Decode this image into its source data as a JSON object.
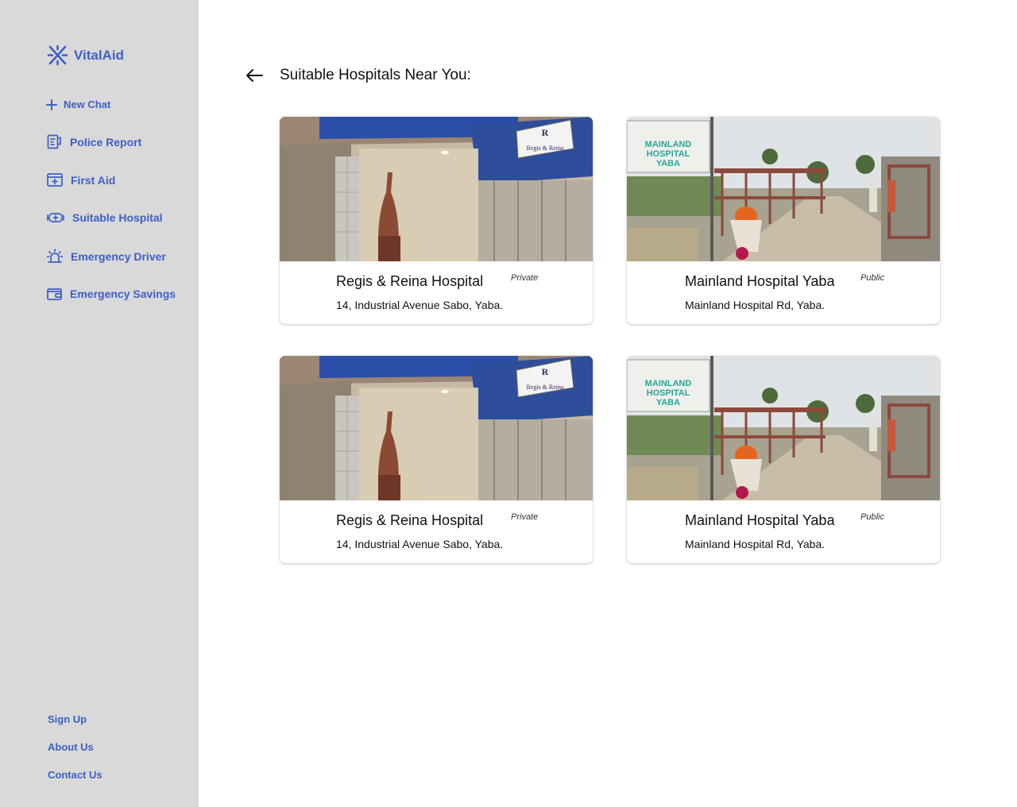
{
  "app": {
    "name": "VitalAid"
  },
  "sidebar": {
    "new_chat": "New Chat",
    "items": [
      {
        "label": "Police Report",
        "icon": "document-icon"
      },
      {
        "label": "First Aid",
        "icon": "first-aid-kit-icon"
      },
      {
        "label": "Suitable Hospital",
        "icon": "hospital-icon"
      },
      {
        "label": "Emergency Driver",
        "icon": "siren-icon"
      },
      {
        "label": "Emergency Savings",
        "icon": "wallet-icon"
      }
    ],
    "footer_links": [
      "Sign Up",
      "About Us",
      "Contact Us"
    ]
  },
  "page": {
    "title": "Suitable Hospitals Near You:"
  },
  "hospitals": [
    {
      "name": "Regis & Reina Hospital",
      "type": "Private",
      "address": "14, Industrial Avenue Sabo, Yaba.",
      "sign_text": "Regis & Reina"
    },
    {
      "name": "Mainland Hospital Yaba",
      "type": "Public",
      "address": "Mainland Hospital Rd, Yaba.",
      "sign_lines": [
        "MAINLAND",
        "HOSPITAL",
        "YABA"
      ]
    },
    {
      "name": "Regis & Reina Hospital",
      "type": "Private",
      "address": "14, Industrial Avenue Sabo, Yaba.",
      "sign_text": "Regis & Reina"
    },
    {
      "name": "Mainland Hospital Yaba",
      "type": "Public",
      "address": "Mainland Hospital Rd, Yaba.",
      "sign_lines": [
        "MAINLAND",
        "HOSPITAL",
        "YABA"
      ]
    }
  ],
  "colors": {
    "accent": "#3e5fc5",
    "sidebar_bg": "#d9d9d9"
  }
}
